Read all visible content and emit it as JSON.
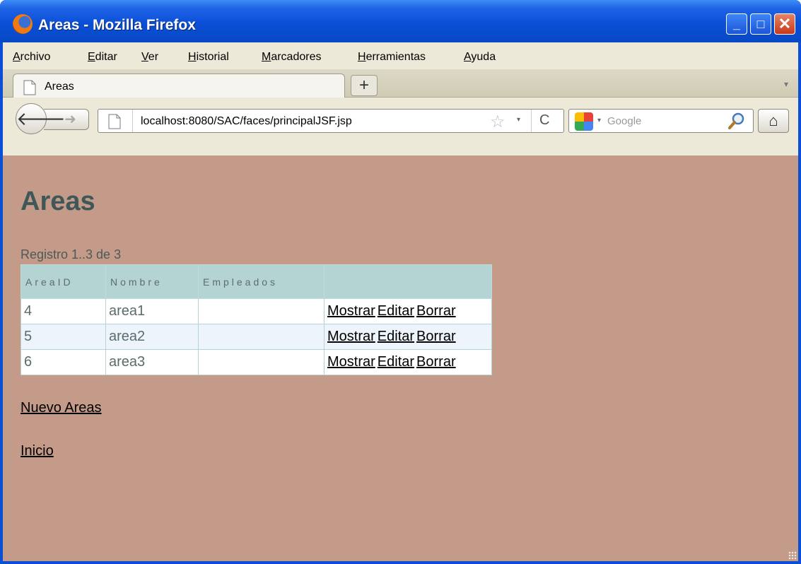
{
  "window": {
    "title": "Areas - Mozilla Firefox",
    "minimize": "_",
    "maximize": "□",
    "close": "✕"
  },
  "menu": {
    "items": [
      {
        "accel": "A",
        "rest": "rchivo"
      },
      {
        "accel": "E",
        "rest": "ditar"
      },
      {
        "accel": "V",
        "rest": "er"
      },
      {
        "accel": "H",
        "rest": "istorial"
      },
      {
        "accel": "M",
        "rest": "arcadores"
      },
      {
        "accel": "H",
        "rest": "erramientas"
      },
      {
        "accel": "A",
        "rest": "yuda"
      }
    ]
  },
  "tabs": {
    "active_title": "Areas",
    "new_tab": "+",
    "list_all": "▾"
  },
  "nav": {
    "back": "🡐",
    "forward": "➜",
    "url": "localhost:8080/SAC/faces/principalJSF.jsp",
    "star": "☆",
    "dropdown": "▾",
    "reload": "C",
    "search_placeholder": "Google",
    "home": "⌂"
  },
  "page": {
    "heading": "Areas",
    "record_info": "Registro 1..3 de 3",
    "table": {
      "headers": [
        "AreaID",
        "Nombre",
        "Empleados",
        ""
      ],
      "rows": [
        {
          "id": "4",
          "name": "area1",
          "employees": "",
          "show": "Mostrar",
          "edit": "Editar",
          "delete": "Borrar"
        },
        {
          "id": "5",
          "name": "area2",
          "employees": "",
          "show": "Mostrar",
          "edit": "Editar",
          "delete": "Borrar"
        },
        {
          "id": "6",
          "name": "area3",
          "employees": "",
          "show": "Mostrar",
          "edit": "Editar",
          "delete": "Borrar"
        }
      ]
    },
    "new_link": "Nuevo Areas",
    "home_link": "Inicio"
  },
  "colors": {
    "page_background": "#c49a88",
    "heading": "#3f5758",
    "table_header": "#b3d4d3",
    "titlebar": "#0a4fd6"
  }
}
